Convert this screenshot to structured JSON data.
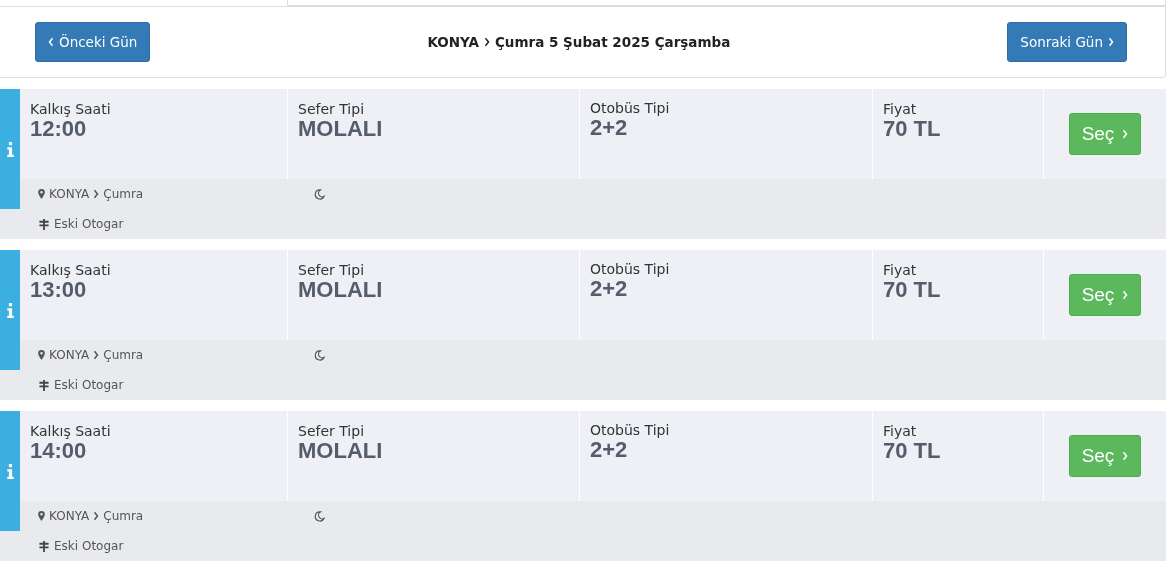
{
  "header": {
    "prev_button": "Önceki Gün",
    "origin": "KONYA",
    "destination_date": "Çumra 5 Şubat 2025 Çarşamba",
    "next_button": "Sonraki Gün"
  },
  "trips": [
    {
      "departure_label": "Kalkış Saati",
      "departure": "12:00",
      "trip_type_label": "Sefer Tipi",
      "trip_type": "MOLALI",
      "bus_type_label": "Otobüs Tipi",
      "bus_type": "2+2",
      "price_label": "Fiyat",
      "price": "70 TL",
      "select_button": "Seç",
      "from": "KONYA",
      "to": "Çumra",
      "terminal": "Eski Otogar"
    },
    {
      "departure_label": "Kalkış Saati",
      "departure": "13:00",
      "trip_type_label": "Sefer Tipi",
      "trip_type": "MOLALI",
      "bus_type_label": "Otobüs Tipi",
      "bus_type": "2+2",
      "price_label": "Fiyat",
      "price": "70 TL",
      "select_button": "Seç",
      "from": "KONYA",
      "to": "Çumra",
      "terminal": "Eski Otogar"
    },
    {
      "departure_label": "Kalkış Saati",
      "departure": "14:00",
      "trip_type_label": "Sefer Tipi",
      "trip_type": "MOLALI",
      "bus_type_label": "Otobüs Tipi",
      "bus_type": "2+2",
      "price_label": "Fiyat",
      "price": "70 TL",
      "select_button": "Seç",
      "from": "KONYA",
      "to": "Çumra",
      "terminal": "Eski Otogar"
    }
  ]
}
